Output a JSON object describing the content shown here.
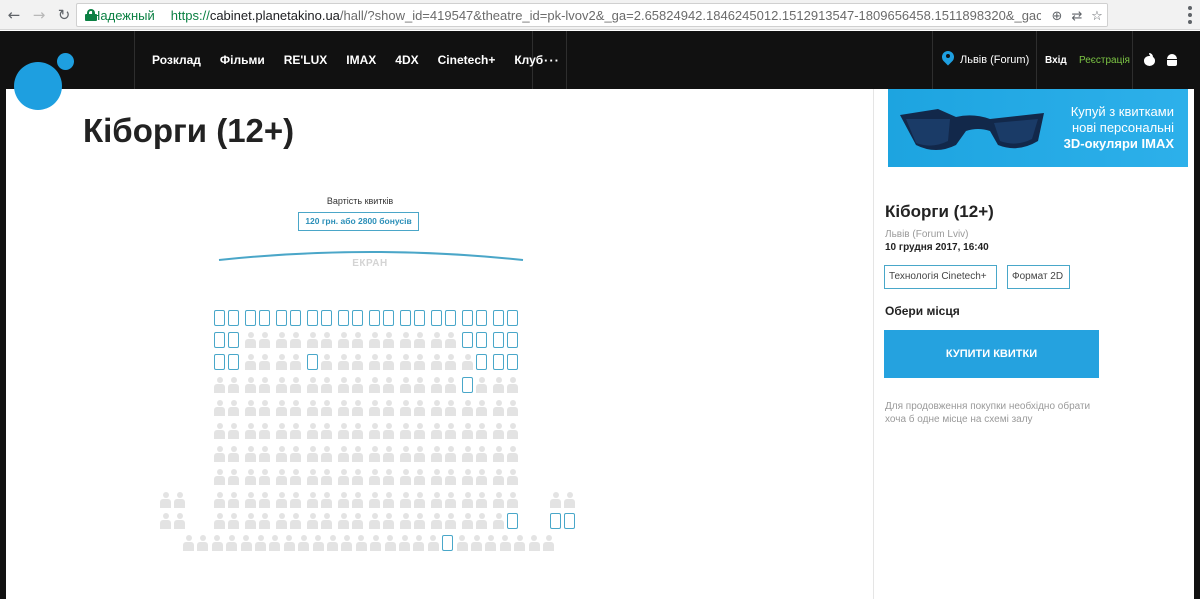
{
  "browser": {
    "back_icon": "arrow-left-icon",
    "forward_icon": "arrow-right-icon",
    "reload_icon": "reload-icon",
    "secure_label": "Надежный",
    "url_proto": "https://",
    "url_host": "cabinet.planetakino.ua",
    "url_rest": "/hall/?show_id=419547&theatre_id=pk-lvov2&_ga=2.65824942.1846245012.1512913547-1809656458.1511898320&_gac=1.25036433...",
    "zoom_icon": "zoom-icon",
    "translate_icon": "translate-icon",
    "star_icon": "star-icon",
    "menu_icon": "kebab-menu-icon"
  },
  "header": {
    "nav": [
      "Розклад",
      "Фільми",
      "RE'LUX",
      "IMAX",
      "4DX",
      "Cinetech+",
      "Клуб"
    ],
    "more": "···",
    "city": "Львів (Forum)",
    "login": "Вхід",
    "register": "Реєстрація",
    "colors": {
      "brand": "#1e9fe0",
      "register": "#7cc544",
      "header_bg": "#111111"
    }
  },
  "main": {
    "title": "Кіборги (12+)",
    "price_caption": "Вартість квитків",
    "price": "120 грн. або 2800 бонусів",
    "screen_label": "ЕКРАН"
  },
  "seatmap": {
    "legend": {
      "free": "seat-free",
      "taken": "seat-taken"
    },
    "colors": {
      "free": "#49a7c9",
      "taken": "#e3e3e3"
    },
    "rows": [
      {
        "row": 1,
        "free": [
          1,
          2,
          3,
          4,
          5,
          6,
          7,
          8,
          9,
          10,
          11,
          12,
          13,
          14,
          15,
          16,
          17,
          18,
          19,
          20
        ]
      },
      {
        "row": 2,
        "free": [
          1,
          2,
          17,
          18,
          19,
          20
        ]
      },
      {
        "row": 3,
        "free": [
          1,
          2,
          7,
          18,
          19,
          20
        ]
      },
      {
        "row": 4,
        "free": [
          17
        ]
      },
      {
        "row": 5,
        "free": []
      },
      {
        "row": 6,
        "free": []
      },
      {
        "row": 7,
        "free": []
      },
      {
        "row": 8,
        "free": []
      },
      {
        "row": 9,
        "free": []
      },
      {
        "row": 10,
        "free": [
          20,
          23,
          24
        ]
      },
      {
        "row": 11,
        "free": [
          19
        ]
      }
    ]
  },
  "banner": {
    "line1": "Купуй з квитками",
    "line2": "нові персональні",
    "line3": "3D-окуляри IMAX"
  },
  "order": {
    "title": "Кіборги (12+)",
    "cinema": "Львів (Forum Lviv)",
    "datetime": "10 грудня 2017, 16:40",
    "tech": "Технологія Cinetech+",
    "format": "Формат 2D",
    "choose": "Обери місця",
    "buy_label": "КУПИТИ КВИТКИ",
    "hint": "Для продовження покупки необхідно обрати хоча б одне місце на схемі залу"
  }
}
